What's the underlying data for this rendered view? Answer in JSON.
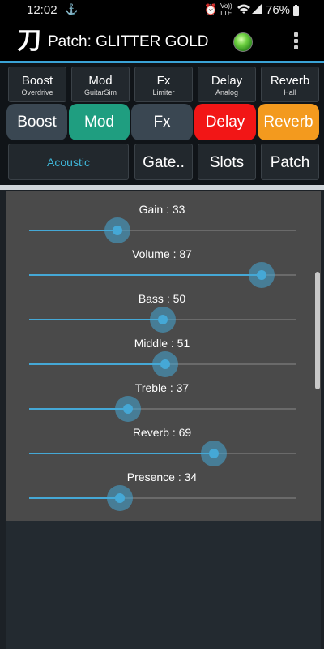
{
  "status_bar": {
    "time": "12:02",
    "lte_top": "Vo))",
    "lte_bottom": "LTE",
    "battery": "76%",
    "icons": [
      "notification-icon",
      "wifi-icon",
      "signal-icon",
      "battery-icon"
    ]
  },
  "app_bar": {
    "logo_glyph": "刀",
    "title": "Patch: GLITTER GOLD",
    "status_led_color": "#6fd142"
  },
  "effect_buttons": [
    {
      "label": "Boost",
      "sub": "Overdrive"
    },
    {
      "label": "Mod",
      "sub": "GuitarSim"
    },
    {
      "label": "Fx",
      "sub": "Limiter"
    },
    {
      "label": "Delay",
      "sub": "Analog"
    },
    {
      "label": "Reverb",
      "sub": "Hall"
    }
  ],
  "block_buttons": [
    {
      "label": "Boost",
      "color": "#3a4752"
    },
    {
      "label": "Mod",
      "color": "#1f9e80"
    },
    {
      "label": "Fx",
      "color": "#3a4752"
    },
    {
      "label": "Delay",
      "color": "#f21616"
    },
    {
      "label": "Reverb",
      "color": "#f39a1e"
    }
  ],
  "row3": {
    "acoustic": "Acoustic",
    "acoustic_color": "#3fb7d9",
    "gate": "Gate..",
    "slots": "Slots",
    "patch": "Patch"
  },
  "sliders": [
    {
      "label": "Gain : 33",
      "value": 33
    },
    {
      "label": "Volume  : 87",
      "value": 87
    },
    {
      "label": "Bass  : 50",
      "value": 50
    },
    {
      "label": "Middle  : 51",
      "value": 51
    },
    {
      "label": "Treble  : 37",
      "value": 37
    },
    {
      "label": "Reverb : 69",
      "value": 69
    },
    {
      "label": "Presence  : 34",
      "value": 34
    }
  ],
  "slider_max": 100
}
